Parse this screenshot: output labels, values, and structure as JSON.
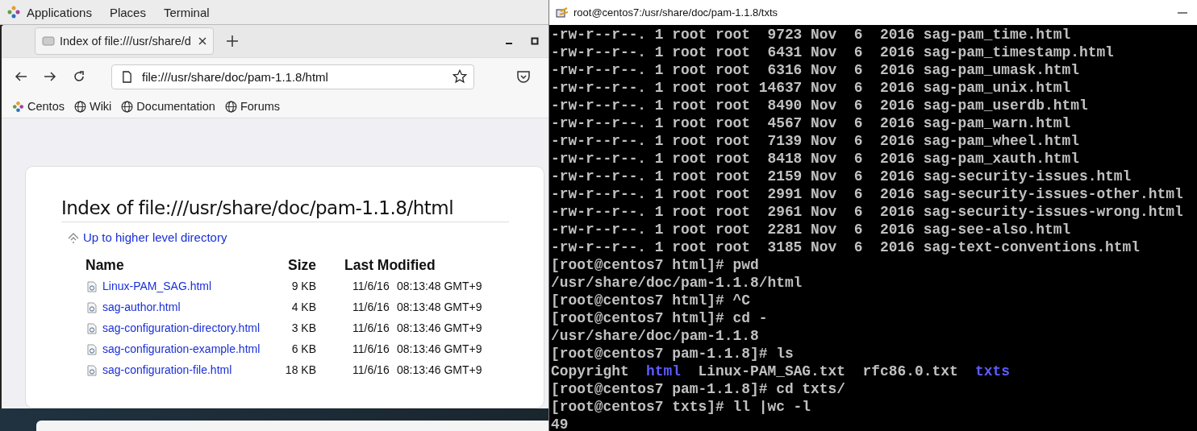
{
  "top_bar": {
    "menus": [
      "Applications",
      "Places",
      "Terminal"
    ]
  },
  "browser": {
    "tabs": [
      {
        "title": "Index of file:///usr/share/d",
        "selected": true
      }
    ],
    "address": "file:///usr/share/doc/pam-1.1.8/html",
    "bookmarks": [
      {
        "label": "Centos",
        "kind": "logo"
      },
      {
        "label": "Wiki",
        "kind": "globe"
      },
      {
        "label": "Documentation",
        "kind": "globe"
      },
      {
        "label": "Forums",
        "kind": "globe"
      }
    ],
    "page": {
      "heading": "Index of file:///usr/share/doc/pam-1.1.8/html",
      "up_link": "Up to higher level directory",
      "columns": [
        "Name",
        "Size",
        "Last Modified"
      ],
      "rows": [
        {
          "name": "Linux-PAM_SAG.html",
          "size": "9 KB",
          "date": "11/6/16",
          "time": "08:13:48 GMT+9"
        },
        {
          "name": "sag-author.html",
          "size": "4 KB",
          "date": "11/6/16",
          "time": "08:13:48 GMT+9"
        },
        {
          "name": "sag-configuration-directory.html",
          "size": "3 KB",
          "date": "11/6/16",
          "time": "08:13:46 GMT+9"
        },
        {
          "name": "sag-configuration-example.html",
          "size": "6 KB",
          "date": "11/6/16",
          "time": "08:13:46 GMT+9"
        },
        {
          "name": "sag-configuration-file.html",
          "size": "18 KB",
          "date": "11/6/16",
          "time": "08:13:46 GMT+9"
        }
      ]
    }
  },
  "terminal": {
    "title": "root@centos7:/usr/share/doc/pam-1.1.8/txts",
    "lines": [
      {
        "kind": "text",
        "text": "-rw-r--r--. 1 root root  9723 Nov  6  2016 sag-pam_time.html"
      },
      {
        "kind": "text",
        "text": "-rw-r--r--. 1 root root  6431 Nov  6  2016 sag-pam_timestamp.html"
      },
      {
        "kind": "text",
        "text": "-rw-r--r--. 1 root root  6316 Nov  6  2016 sag-pam_umask.html"
      },
      {
        "kind": "text",
        "text": "-rw-r--r--. 1 root root 14637 Nov  6  2016 sag-pam_unix.html"
      },
      {
        "kind": "text",
        "text": "-rw-r--r--. 1 root root  8490 Nov  6  2016 sag-pam_userdb.html"
      },
      {
        "kind": "text",
        "text": "-rw-r--r--. 1 root root  4567 Nov  6  2016 sag-pam_warn.html"
      },
      {
        "kind": "text",
        "text": "-rw-r--r--. 1 root root  7139 Nov  6  2016 sag-pam_wheel.html"
      },
      {
        "kind": "text",
        "text": "-rw-r--r--. 1 root root  8418 Nov  6  2016 sag-pam_xauth.html"
      },
      {
        "kind": "text",
        "text": "-rw-r--r--. 1 root root  2159 Nov  6  2016 sag-security-issues.html"
      },
      {
        "kind": "text",
        "text": "-rw-r--r--. 1 root root  2991 Nov  6  2016 sag-security-issues-other.html"
      },
      {
        "kind": "text",
        "text": "-rw-r--r--. 1 root root  2961 Nov  6  2016 sag-security-issues-wrong.html"
      },
      {
        "kind": "text",
        "text": "-rw-r--r--. 1 root root  2281 Nov  6  2016 sag-see-also.html"
      },
      {
        "kind": "text",
        "text": "-rw-r--r--. 1 root root  3185 Nov  6  2016 sag-text-conventions.html"
      },
      {
        "kind": "text",
        "text": "[root@centos7 html]# pwd"
      },
      {
        "kind": "text",
        "text": "/usr/share/doc/pam-1.1.8/html"
      },
      {
        "kind": "text",
        "text": "[root@centos7 html]# ^C"
      },
      {
        "kind": "text",
        "text": "[root@centos7 html]# cd -"
      },
      {
        "kind": "text",
        "text": "/usr/share/doc/pam-1.1.8"
      },
      {
        "kind": "text",
        "text": "[root@centos7 pam-1.1.8]# ls"
      },
      {
        "kind": "ls",
        "items": [
          {
            "text": "Copyright",
            "dir": false
          },
          {
            "text": "html",
            "dir": true
          },
          {
            "text": "Linux-PAM_SAG.txt",
            "dir": false
          },
          {
            "text": "rfc86.0.txt",
            "dir": false
          },
          {
            "text": "txts",
            "dir": true
          }
        ]
      },
      {
        "kind": "text",
        "text": "[root@centos7 pam-1.1.8]# cd txts/"
      },
      {
        "kind": "text",
        "text": "[root@centos7 txts]# ll |wc -l"
      },
      {
        "kind": "text",
        "text": "49"
      }
    ]
  }
}
